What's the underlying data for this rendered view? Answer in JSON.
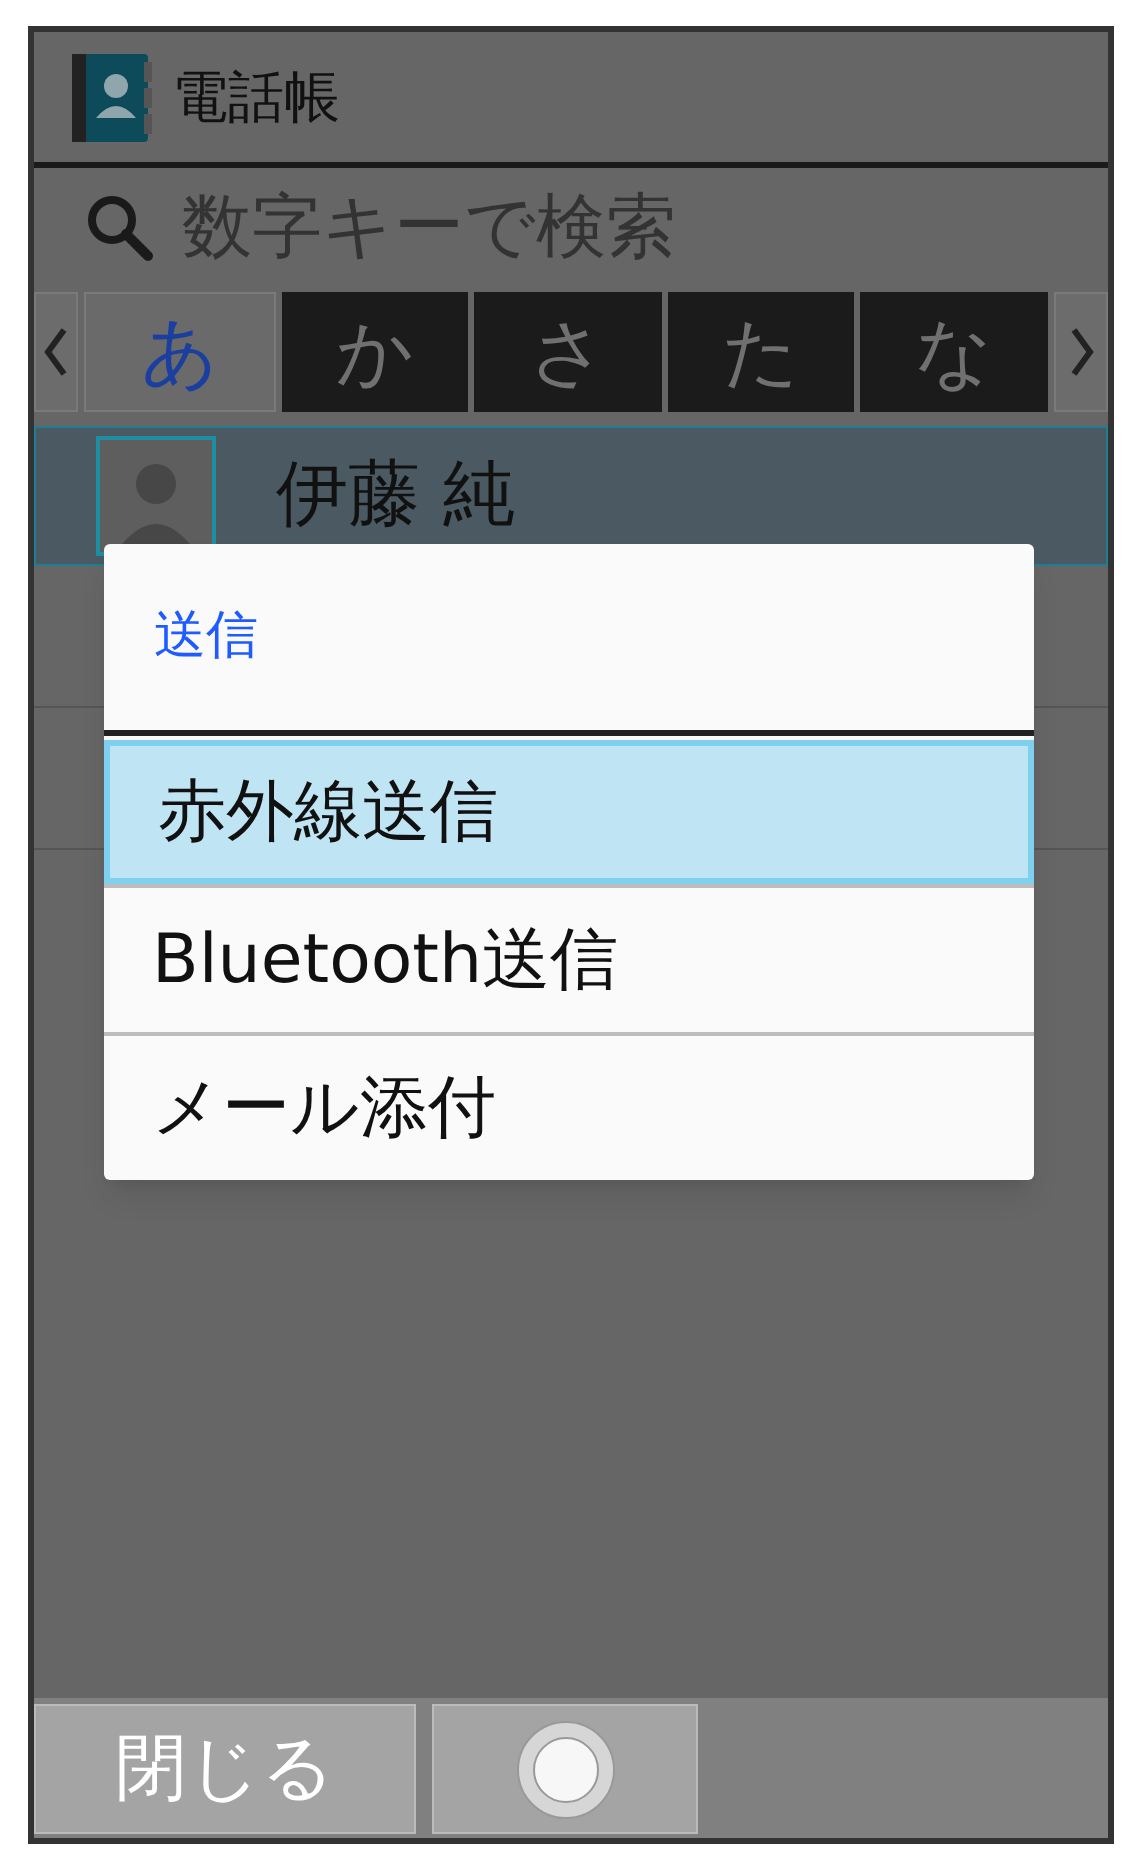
{
  "app_title": "電話帳",
  "search": {
    "placeholder": "数字キーで検索"
  },
  "index_tabs": [
    {
      "label": "あ",
      "selected": true
    },
    {
      "label": "か",
      "selected": false
    },
    {
      "label": "さ",
      "selected": false
    },
    {
      "label": "た",
      "selected": false
    },
    {
      "label": "な",
      "selected": false
    }
  ],
  "contacts": [
    {
      "name": "伊藤 純",
      "selected": true
    }
  ],
  "dialog": {
    "title": "送信",
    "options": [
      {
        "label": "赤外線送信",
        "selected": true
      },
      {
        "label": "Bluetooth送信",
        "selected": false
      },
      {
        "label": "メール添付",
        "selected": false
      }
    ]
  },
  "softkeys": [
    {
      "kind": "text",
      "label": "閉じる"
    },
    {
      "kind": "center"
    }
  ]
}
